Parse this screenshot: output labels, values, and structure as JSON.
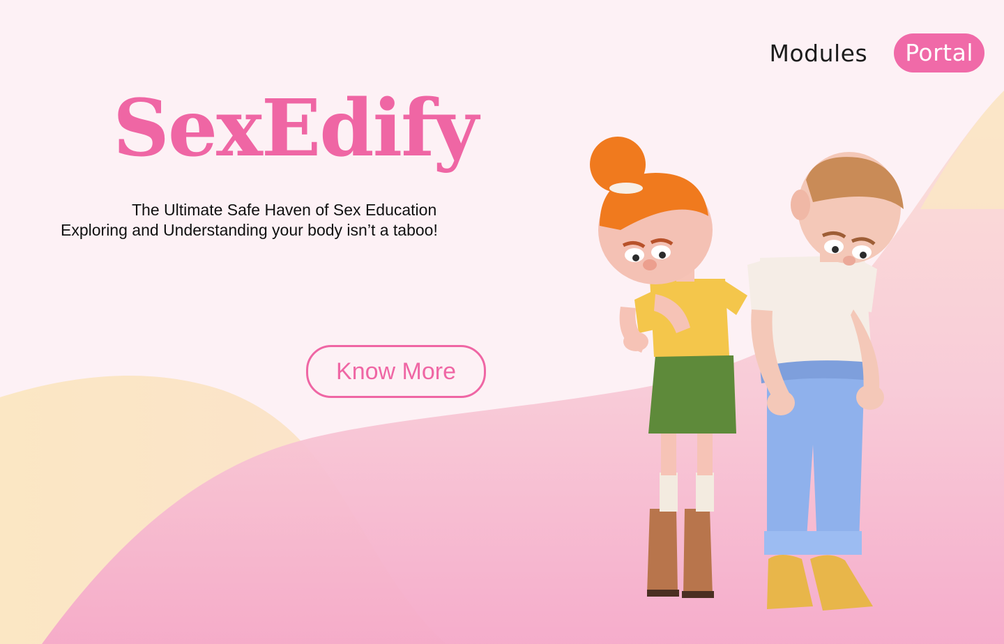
{
  "nav": {
    "modules_label": "Modules",
    "portal_label": "Portal"
  },
  "hero": {
    "brand": "SexEdify",
    "tagline_1": "The Ultimate Safe Haven of Sex Education",
    "tagline_2": "Exploring and Understanding your body isn’t a taboo!",
    "cta_label": "Know More"
  },
  "colors": {
    "accent": "#ef66a4",
    "background": "#fdf1f5",
    "wave_cream": "#fbe6c6",
    "wave_pink": "#f7b8d2"
  },
  "illustration": {
    "icon": "two-characters-illustration"
  }
}
